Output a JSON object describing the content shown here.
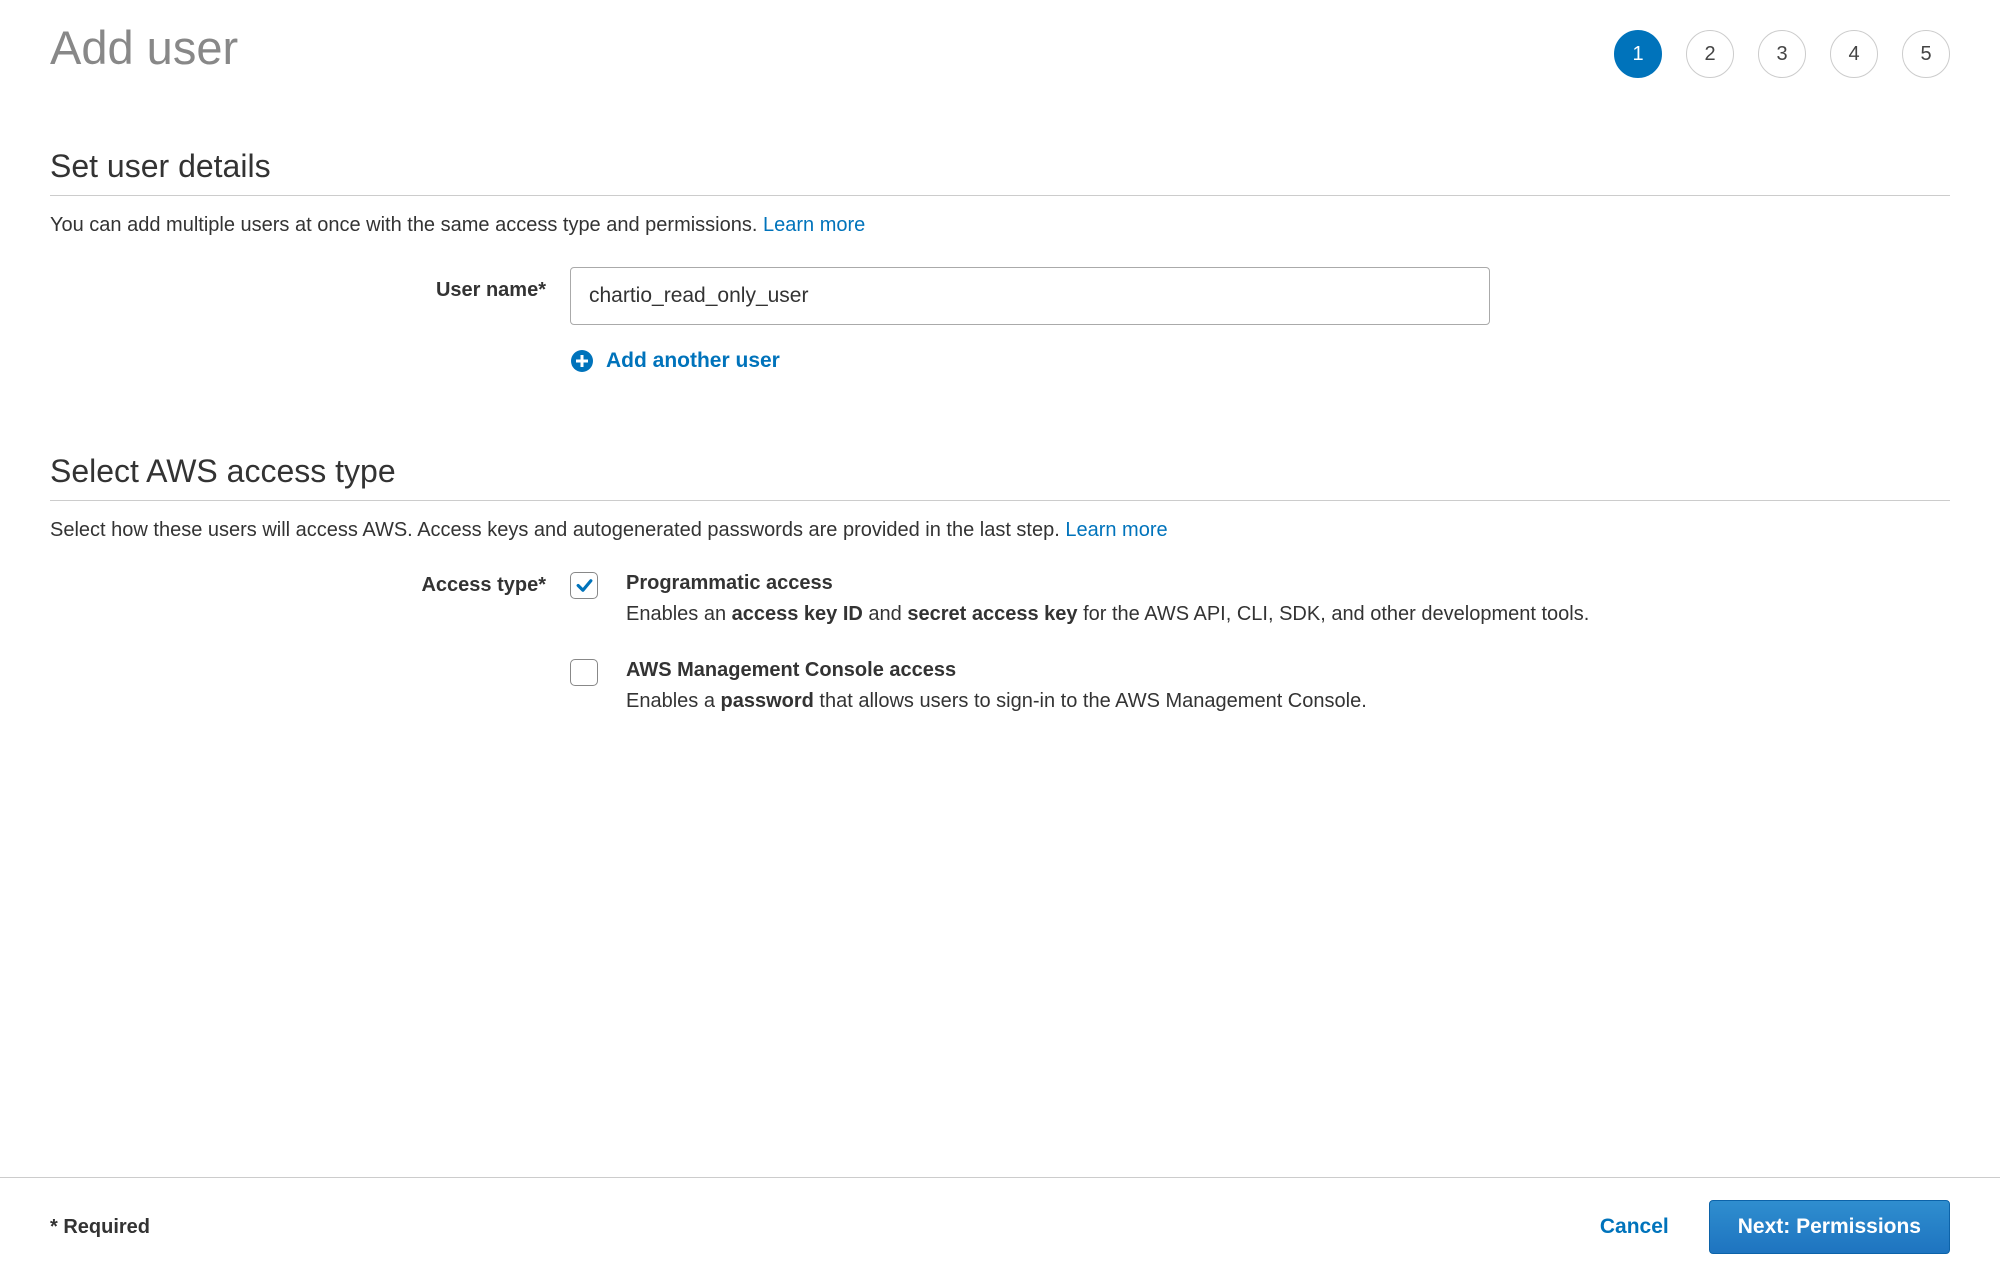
{
  "page": {
    "title": "Add user"
  },
  "steps": [
    "1",
    "2",
    "3",
    "4",
    "5"
  ],
  "section1": {
    "title": "Set user details",
    "description": "You can add multiple users at once with the same access type and permissions. ",
    "learn_more": "Learn more",
    "username_label": "User name*",
    "username_value": "chartio_read_only_user",
    "add_another": "Add another user"
  },
  "section2": {
    "title": "Select AWS access type",
    "description": "Select how these users will access AWS. Access keys and autogenerated passwords are provided in the last step. ",
    "learn_more": "Learn more",
    "access_type_label": "Access type*",
    "option1": {
      "title": "Programmatic access",
      "desc_pre": "Enables an ",
      "desc_b1": "access key ID",
      "desc_mid": " and ",
      "desc_b2": "secret access key",
      "desc_post": " for the AWS API, CLI, SDK, and other development tools.",
      "checked": true
    },
    "option2": {
      "title": "AWS Management Console access",
      "desc_pre": "Enables a ",
      "desc_b1": "password",
      "desc_post": " that allows users to sign-in to the AWS Management Console.",
      "checked": false
    }
  },
  "footer": {
    "required": "* Required",
    "cancel": "Cancel",
    "next": "Next: Permissions"
  }
}
